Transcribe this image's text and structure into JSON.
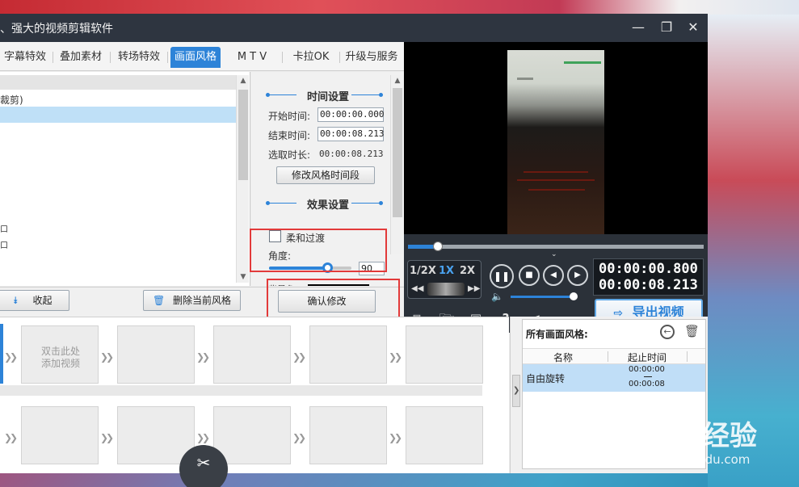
{
  "window": {
    "title": "、强大的视频剪辑软件",
    "minimize_glyph": "—",
    "maximize_glyph": "❐",
    "close_glyph": "✕"
  },
  "tabs": [
    {
      "label": "字幕特效",
      "active": false
    },
    {
      "label": "叠加素材",
      "active": false
    },
    {
      "label": "转场特效",
      "active": false
    },
    {
      "label": "画面风格",
      "active": true
    },
    {
      "label": "M T V",
      "active": false
    },
    {
      "label": "卡拉OK",
      "active": false
    },
    {
      "label": "升级与服务",
      "active": false
    }
  ],
  "style_list": {
    "items": [
      "裁剪)",
      "",
      "",
      "",
      "",
      "",
      "",
      "",
      "",
      "口",
      "口"
    ]
  },
  "settings": {
    "time_section_title": "时间设置",
    "start_label": "开始时间:",
    "start_value": "00:00:00.000",
    "end_label": "结束时间:",
    "end_value": "00:00:08.213",
    "duration_label": "选取时长:",
    "duration_value": "00:00:08.213",
    "modify_time_button": "修改风格时间段",
    "effect_section_title": "效果设置",
    "smooth_transition_label": "柔和过渡",
    "smooth_transition_checked": false,
    "angle_label": "角度:",
    "angle_value": "90",
    "angle_slider_fraction": 0.71,
    "bg_color_label": "背景色:",
    "confirm_button": "确认修改"
  },
  "left_bottom": {
    "collapse_button": "收起",
    "delete_button": "删除当前风格"
  },
  "player": {
    "progress_fraction": 0.1,
    "speeds": [
      {
        "label": "1/2X",
        "active": false
      },
      {
        "label": "1X",
        "active": true
      },
      {
        "label": "2X",
        "active": false
      }
    ],
    "current_time": "00:00:00.800",
    "total_time": "00:00:08.213",
    "volume_fraction": 1.0,
    "export_button": "导出视频"
  },
  "timeline": {
    "add_video_hint_line1": "双击此处",
    "add_video_hint_line2": "添加视频"
  },
  "right_panel": {
    "title": "所有画面风格:",
    "col_name": "名称",
    "col_time": "起止时间",
    "rows": [
      {
        "name": "自由旋转",
        "start": "00:00:00",
        "end": "00:00:08"
      }
    ]
  },
  "watermark": {
    "brand": "Baidu经验",
    "url": "jingyan.baidu.com"
  },
  "colors": {
    "accent": "#2d83d8",
    "highlight_box": "#e23a3a",
    "titlebar": "#2e3540",
    "player_bg": "#2b3139"
  }
}
